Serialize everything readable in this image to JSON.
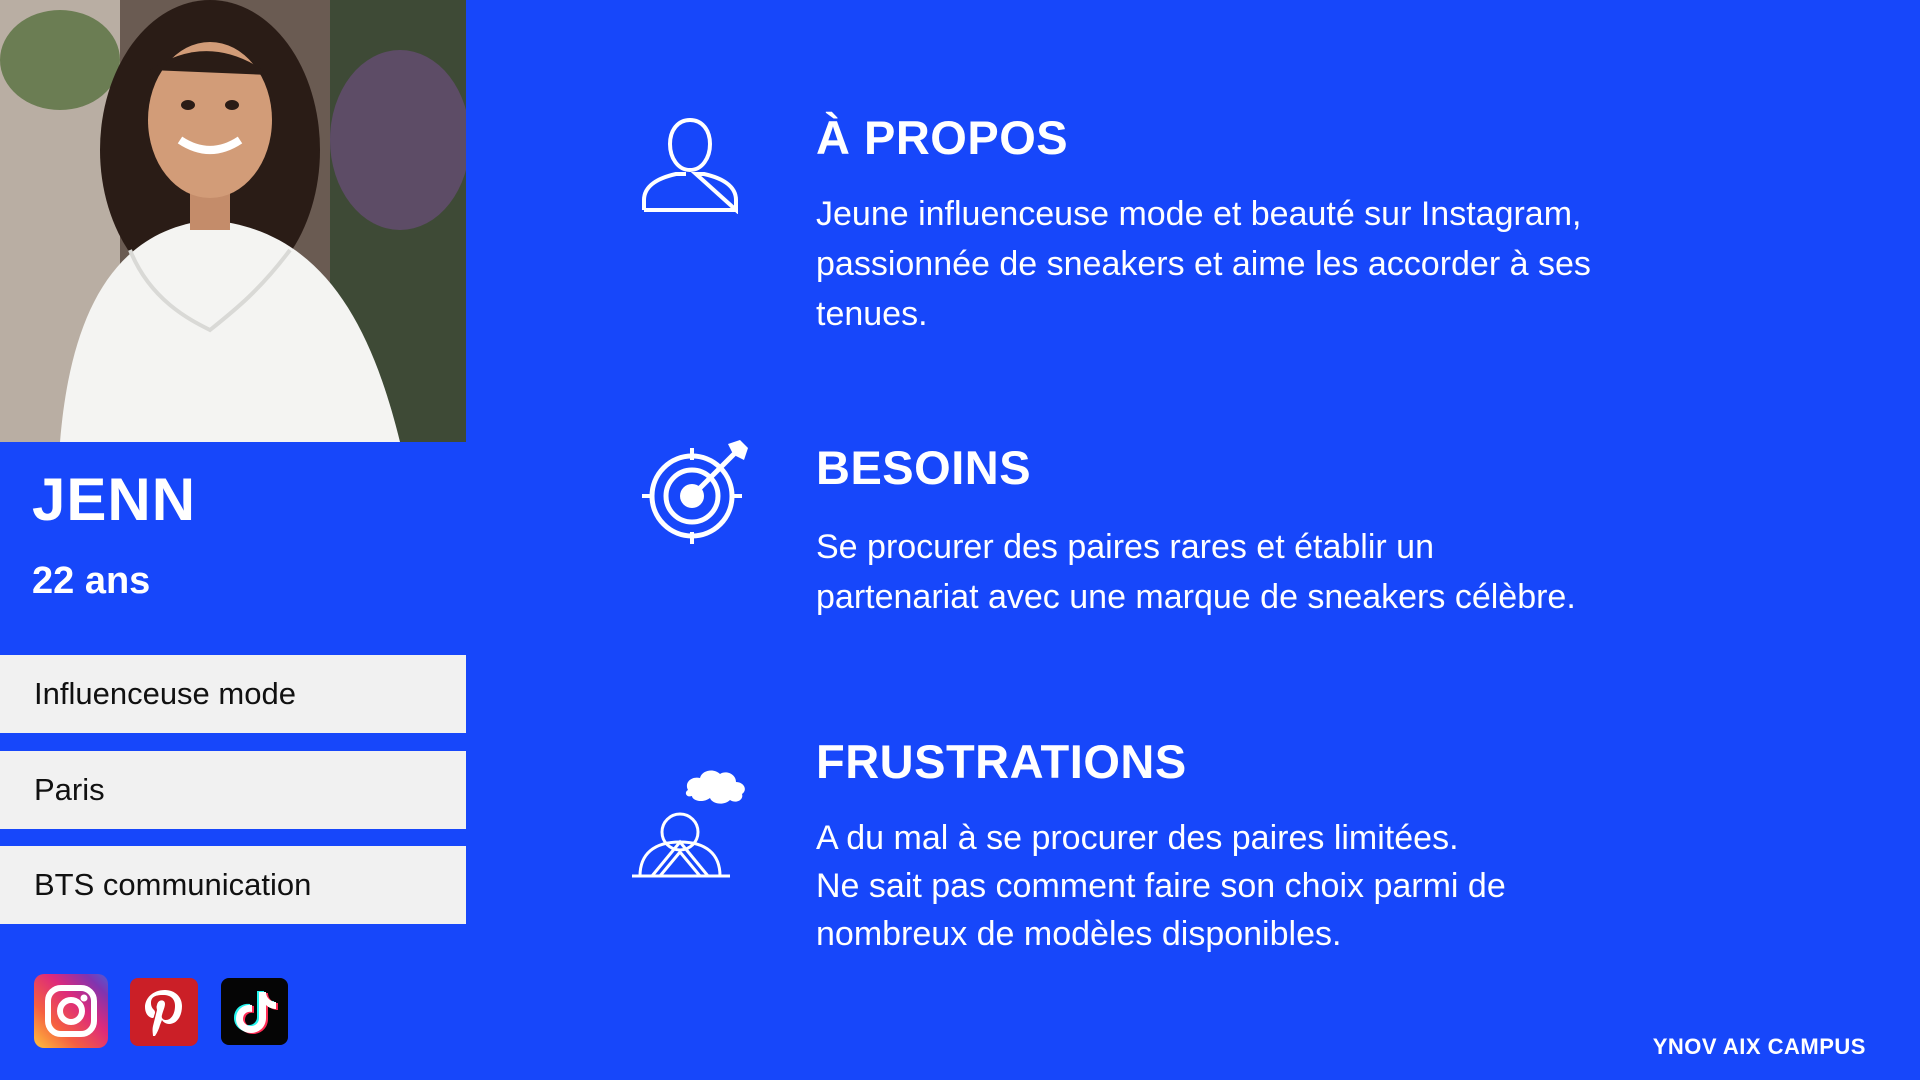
{
  "persona": {
    "name": "JENN",
    "age": "22 ans",
    "tags": [
      "Influenceuse mode",
      "Paris",
      "BTS communication"
    ],
    "photo_icon": "portrait-photo",
    "social": [
      {
        "icon": "instagram-icon"
      },
      {
        "icon": "pinterest-icon"
      },
      {
        "icon": "tiktok-icon"
      }
    ]
  },
  "sections": {
    "about": {
      "icon": "user-icon",
      "title": "À PROPOS",
      "lines": [
        "Jeune influenceuse mode et beauté sur Instagram,",
        "passionnée de sneakers et aime les accorder à ses",
        "tenues."
      ]
    },
    "needs": {
      "icon": "target-icon",
      "title": "BESOINS",
      "lines": [
        "Se procurer des paires rares et établir un",
        "partenariat avec une marque de sneakers célèbre."
      ]
    },
    "frustrations": {
      "icon": "frustrated-person-cloud-icon",
      "title": "FRUSTRATIONS",
      "lines": [
        "A du mal à se procurer des paires limitées.",
        "Ne sait pas comment faire son choix parmi de",
        "nombreux de modèles disponibles."
      ]
    }
  },
  "footer": "YNOV AIX CAMPUS",
  "colors": {
    "background": "#1747FA",
    "tag_background": "#F1F1F1",
    "text": "#FFFFFF"
  }
}
